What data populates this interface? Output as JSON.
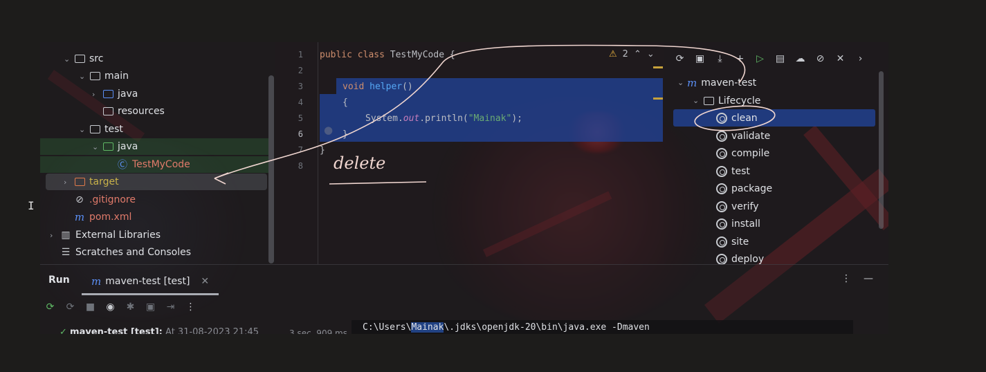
{
  "colors": {
    "background": "#1d1c1b",
    "selection": "#214283",
    "accent_blue": "#5b8ff5",
    "run_green": "#5fb865",
    "annotation": "#f0d6d0"
  },
  "project_tree": {
    "items": [
      {
        "label": "src",
        "icon": "folder-icon",
        "expanded": true
      },
      {
        "label": "main",
        "icon": "folder-icon",
        "expanded": true
      },
      {
        "label": "java",
        "icon": "source-folder-icon",
        "expanded": false
      },
      {
        "label": "resources",
        "icon": "resources-folder-icon"
      },
      {
        "label": "test",
        "icon": "folder-icon",
        "expanded": true
      },
      {
        "label": "java",
        "icon": "test-folder-icon",
        "expanded": true
      },
      {
        "label": "TestMyCode",
        "icon": "class-icon"
      },
      {
        "label": "target",
        "icon": "excluded-folder-icon",
        "expanded": false
      },
      {
        "label": ".gitignore",
        "icon": "ignored-file-icon"
      },
      {
        "label": "pom.xml",
        "icon": "maven-icon"
      },
      {
        "label": "External Libraries",
        "icon": "libraries-icon",
        "expanded": false
      },
      {
        "label": "Scratches and Consoles",
        "icon": "scratches-icon"
      }
    ]
  },
  "editor": {
    "line_numbers": [
      "1",
      "2",
      "3",
      "4",
      "5",
      "6",
      "7",
      "8"
    ],
    "line1": {
      "kw1": "public",
      "kw2": "class",
      "name": "TestMyCode",
      "brace": " {"
    },
    "line3": {
      "kw": "void",
      "name": "helper",
      "parens": "()"
    },
    "line4": {
      "brace": "{"
    },
    "line5": {
      "prefix": "System.",
      "field": "out",
      "call": ".println(",
      "string": "\"Mainak\"",
      "suffix": ");"
    },
    "line6": {
      "brace": "}"
    },
    "line7": {
      "brace": "}"
    },
    "warnings": {
      "count": "2",
      "icon": "warning-icon"
    }
  },
  "maven": {
    "toolbar": [
      "reload-icon",
      "add-project-icon",
      "download-icon",
      "add-icon",
      "run-icon",
      "execute-goal-icon",
      "offline-icon",
      "skip-tests-icon",
      "collapse-icon",
      "more-icon"
    ],
    "project": "maven-test",
    "lifecycle": "Lifecycle",
    "goals": [
      "clean",
      "validate",
      "compile",
      "test",
      "package",
      "verify",
      "install",
      "site",
      "deploy"
    ],
    "selected_goal": "clean"
  },
  "run": {
    "label": "Run",
    "tab_label": "maven-test [test]",
    "tree_item": "maven-test [test]:",
    "tree_item_detail": "At 31-08-2023 21:45",
    "duration": "3 sec, 909 ms",
    "console_prefix": "C:\\Users\\",
    "console_user": "Mainak",
    "console_suffix": "\\.jdks\\openjdk-20\\bin\\java.exe -Dmaven"
  },
  "annotation": {
    "text": "delete"
  }
}
